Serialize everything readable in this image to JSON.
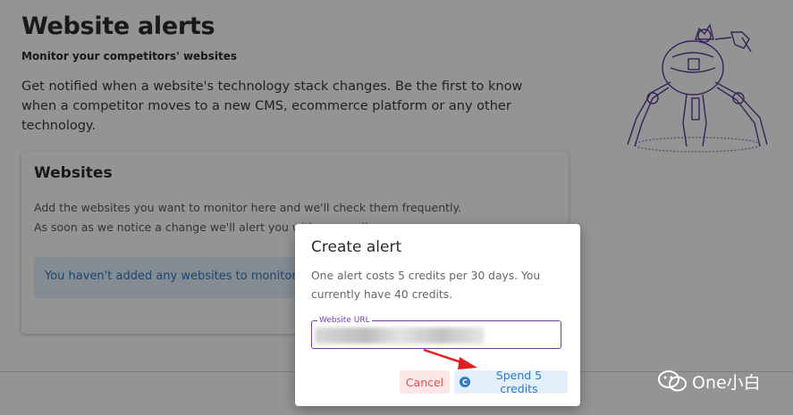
{
  "page": {
    "title": "Website alerts",
    "subtitle": "Monitor your competitors' websites",
    "description": "Get notified when a website's technology stack changes. Be the first to know when a competitor moves to a new CMS, ecommerce platform or any other technology."
  },
  "card": {
    "title": "Websites",
    "text": "Add the websites you want to monitor here and we'll check them frequently. As soon as we notice a change we'll alert you with an email.",
    "info": "You haven't added any websites to monitor yet."
  },
  "modal": {
    "title": "Create alert",
    "text": "One alert costs 5 credits per 30 days. You currently have 40 credits.",
    "url_label": "Website URL",
    "url_value": "",
    "cancel_label": "Cancel",
    "spend_label": "Spend 5 credits",
    "credit_icon": "C"
  },
  "watermark": {
    "text": "One小白",
    "icon": "wechat-icon"
  },
  "colors": {
    "accent": "#6f3fa6",
    "info_blue": "#2f7ac2",
    "cancel_red": "#e15252",
    "arrow_red": "#e02020"
  }
}
